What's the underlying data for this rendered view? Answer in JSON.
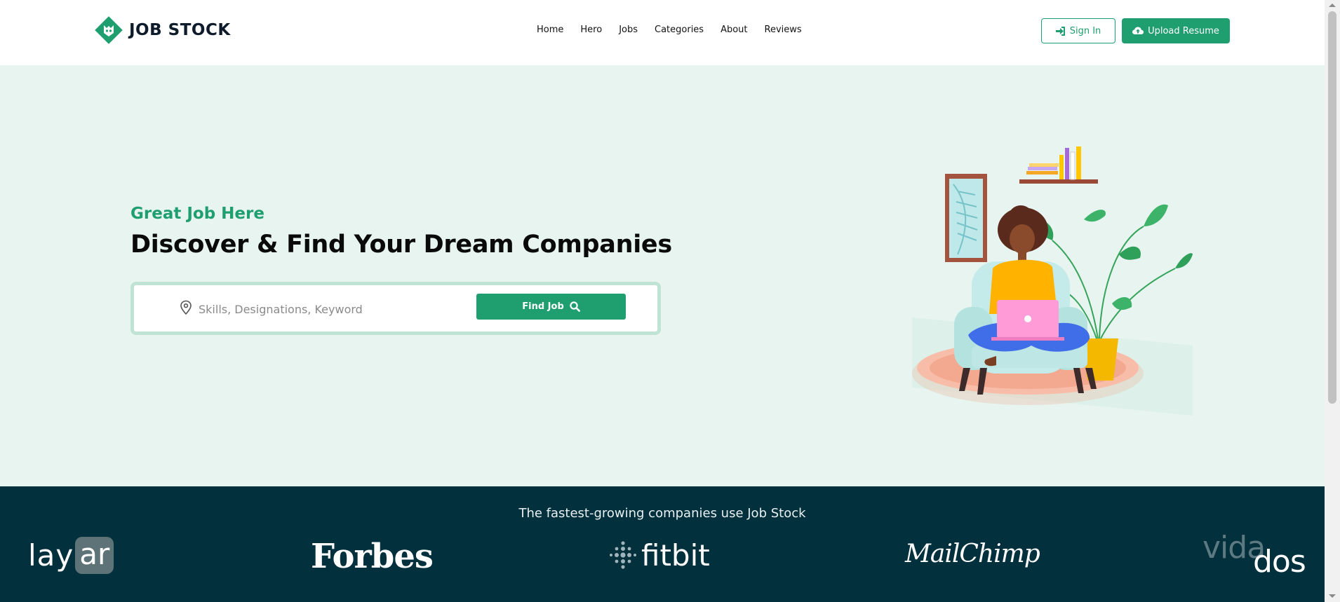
{
  "header": {
    "logo_text": "JOB STOCK",
    "nav": [
      "Home",
      "Hero",
      "Jobs",
      "Categories",
      "About",
      "Reviews"
    ],
    "sign_in_label": "Sign In",
    "upload_label": "Upload Resume"
  },
  "hero": {
    "subtitle": "Great Job Here",
    "title": "Discover & Find Your Dream Companies",
    "search": {
      "placeholder": "Skills, Designations, Keyword",
      "value": "",
      "button_label": "Find Job"
    }
  },
  "companies": {
    "heading": "The fastest-growing companies use Job Stock",
    "logos": {
      "layar_a": "lay",
      "layar_b": "ar",
      "forbes": "Forbes",
      "fitbit": "fitbit",
      "mailchimp": "MailChimp",
      "vidados_a": "vida",
      "vidados_b": "dos"
    }
  },
  "colors": {
    "brand_green": "#1f9e6f",
    "hero_bg": "#e7f4ef",
    "dark_band": "#02303c"
  },
  "icons": [
    "logo-icon",
    "sign-in-icon",
    "cloud-upload-icon",
    "location-pin-icon",
    "search-icon"
  ]
}
